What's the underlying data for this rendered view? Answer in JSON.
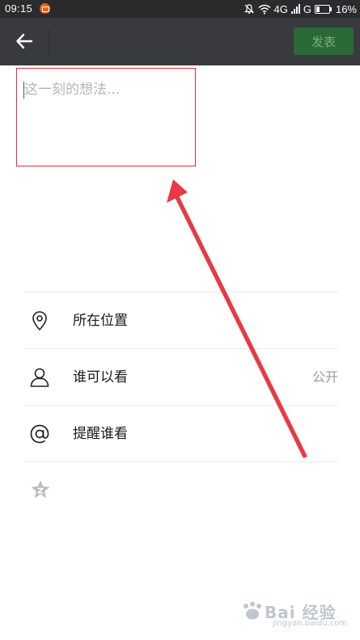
{
  "status_bar": {
    "time": "09:15",
    "network": "4G",
    "carrier_signal": "G",
    "battery": "16%"
  },
  "title_bar": {
    "post_label": "发表"
  },
  "composer": {
    "placeholder": "这一刻的想法..."
  },
  "options": {
    "location_label": "所在位置",
    "visibility_label": "谁可以看",
    "visibility_value": "公开",
    "mention_label": "提醒谁看"
  },
  "icons": {
    "back": "arrow-left-icon",
    "location": "location-pin-icon",
    "visibility": "person-icon",
    "mention": "at-sign-icon",
    "extra": "star-icon"
  },
  "colors": {
    "title_bar": "#393a3e",
    "status_bar": "#2b2b2d",
    "post_button": "#2a6a37",
    "annotation": "#e83a44"
  },
  "watermark": {
    "brand": "Bai 经验",
    "url": "jingyan.baidu.com"
  }
}
